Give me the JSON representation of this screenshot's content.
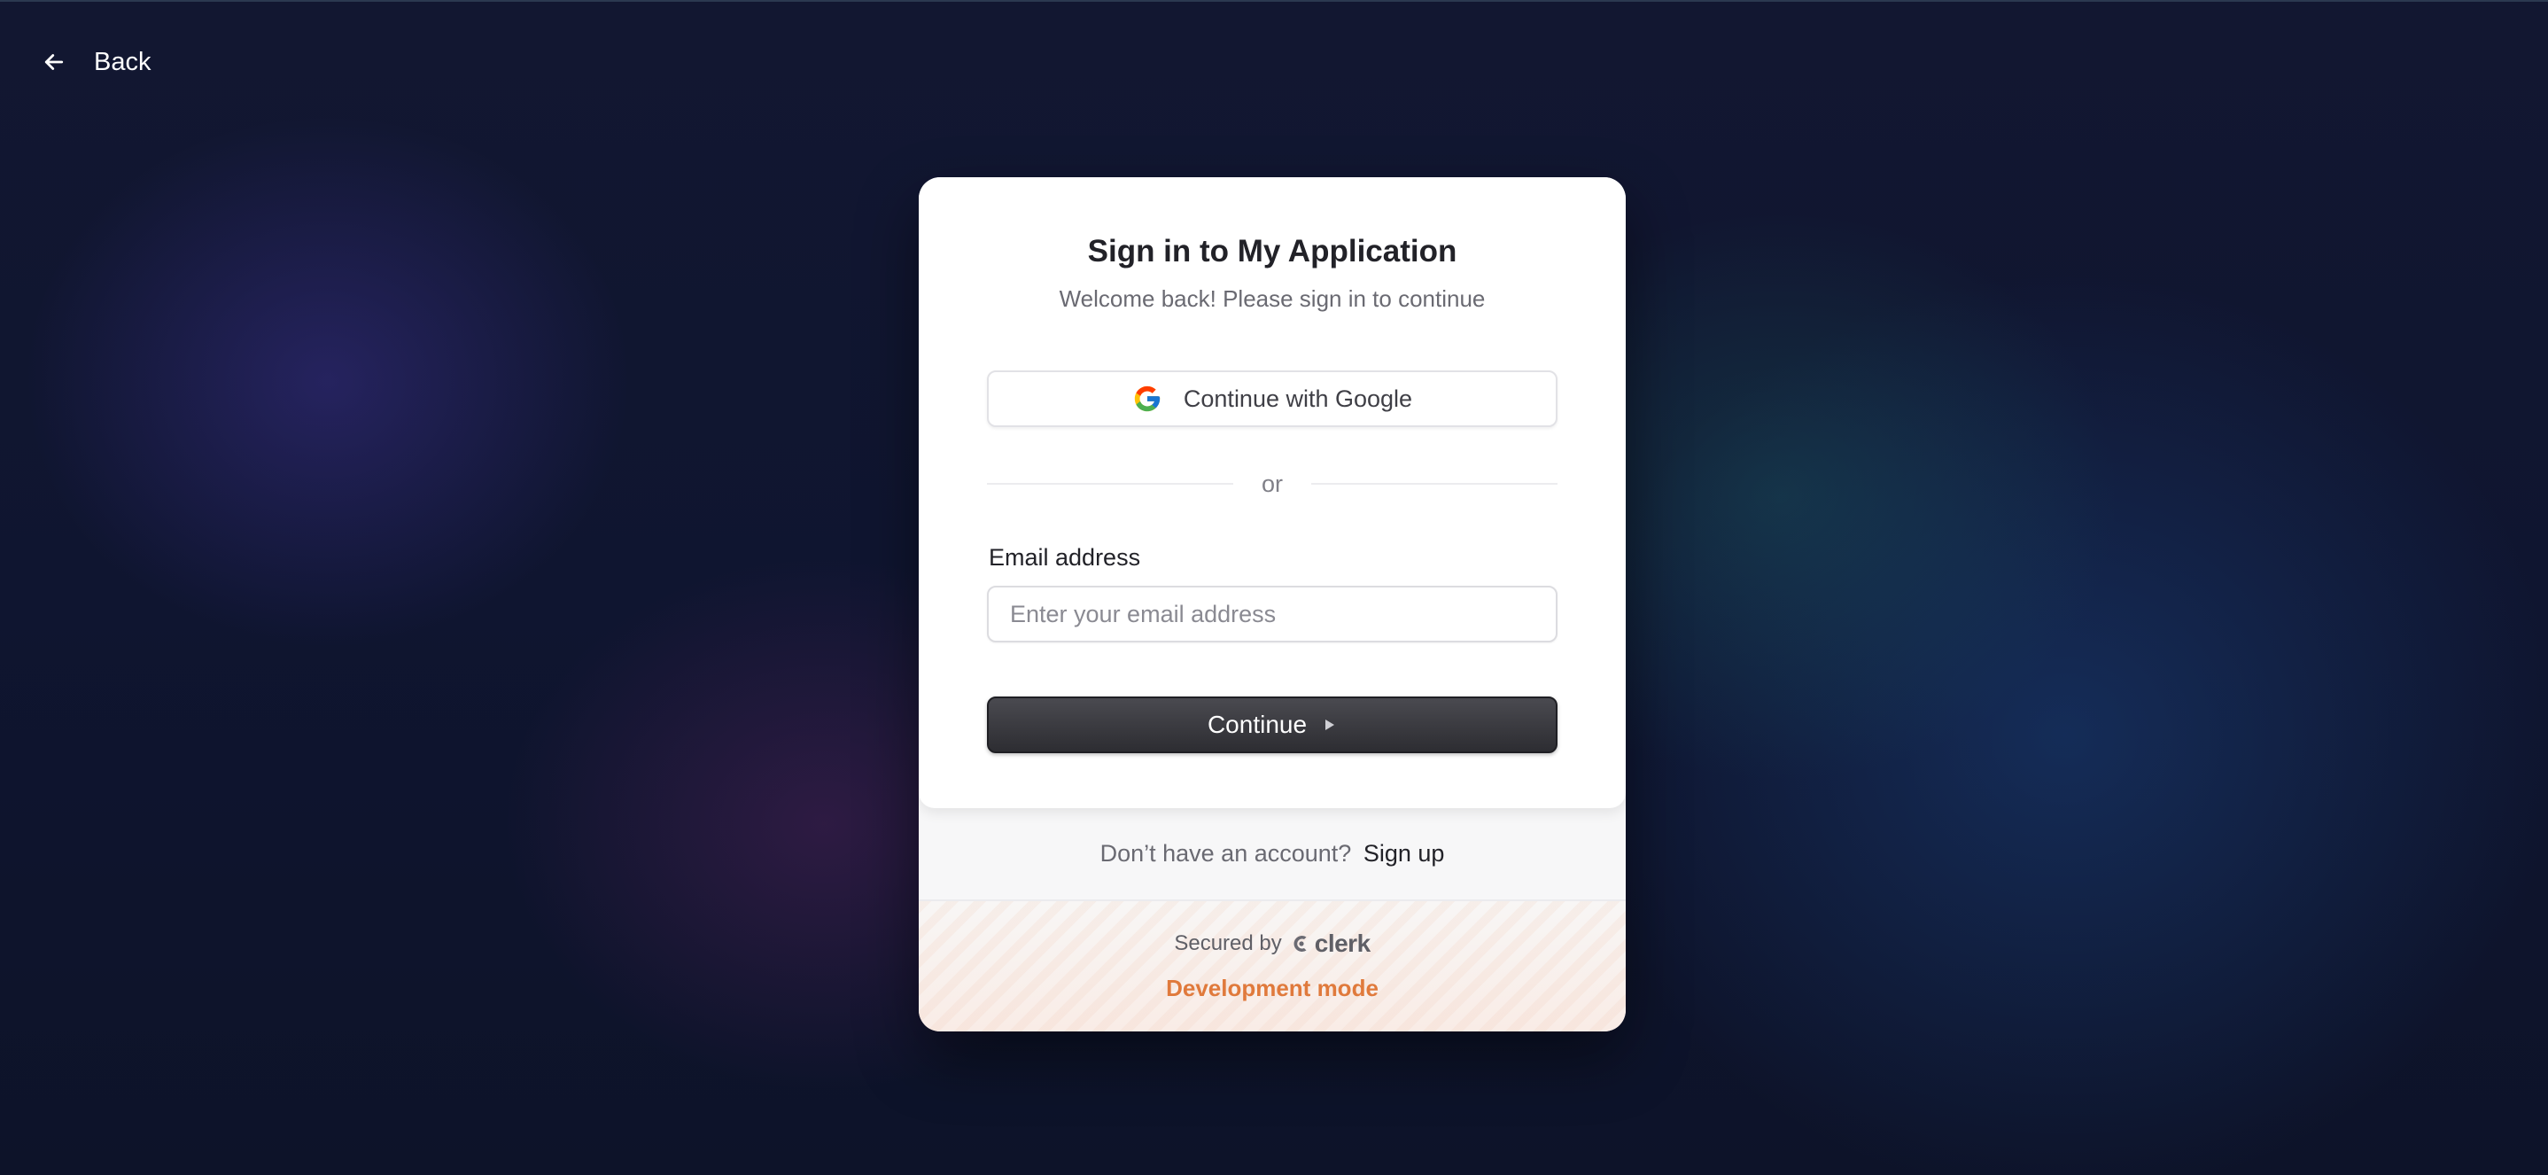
{
  "header": {
    "back_label": "Back"
  },
  "card": {
    "title": "Sign in to My Application",
    "subtitle": "Welcome back! Please sign in to continue",
    "google_button_label": "Continue with Google",
    "divider_text": "or",
    "email": {
      "label": "Email address",
      "placeholder": "Enter your email address",
      "value": ""
    },
    "continue_label": "Continue"
  },
  "signup": {
    "prompt": "Don’t have an account?",
    "link_label": "Sign up"
  },
  "footer": {
    "secured_by": "Secured by",
    "brand": "clerk",
    "mode_badge": "Development mode"
  },
  "icons": {
    "back": "arrow-left-icon",
    "google": "google-logo-icon",
    "continue": "triangle-right-icon",
    "clerk": "clerk-logo-icon"
  },
  "colors": {
    "primary_button": "#2d2d32",
    "dev_mode_accent": "#e07a3c",
    "background": "#0f1530"
  }
}
